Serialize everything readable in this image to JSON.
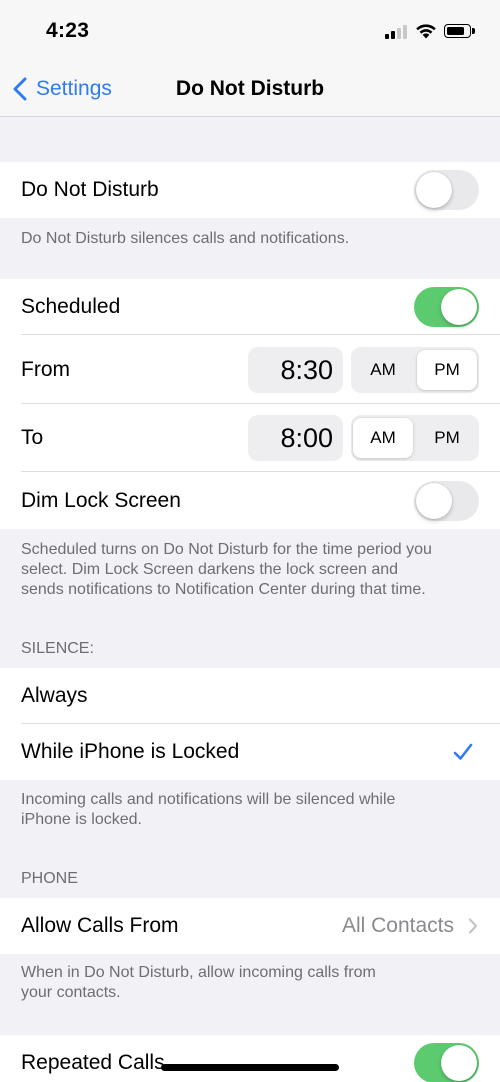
{
  "status_bar": {
    "time": "4:23"
  },
  "nav": {
    "back_label": "Settings",
    "title": "Do Not Disturb"
  },
  "dnd": {
    "label": "Do Not Disturb",
    "enabled": false,
    "footer": "Do Not Disturb silences calls and notifications."
  },
  "schedule": {
    "scheduled_label": "Scheduled",
    "scheduled_enabled": true,
    "from_label": "From",
    "from_time": "8:30",
    "from_period": "PM",
    "to_label": "To",
    "to_time": "8:00",
    "to_period": "AM",
    "am_label": "AM",
    "pm_label": "PM",
    "dim_label": "Dim Lock Screen",
    "dim_enabled": false,
    "footer_line1": "Scheduled turns on Do Not Disturb for the time period you",
    "footer_line2": "select. Dim Lock Screen darkens the lock screen and",
    "footer_line3": "sends notifications to Notification Center during that time."
  },
  "silence": {
    "header": "SILENCE:",
    "options": [
      "Always",
      "While iPhone is Locked"
    ],
    "selected": "While iPhone is Locked",
    "footer_line1": "Incoming calls and notifications will be silenced while",
    "footer_line2": "iPhone is locked."
  },
  "phone": {
    "header": "PHONE",
    "allow_calls_label": "Allow Calls From",
    "allow_calls_value": "All Contacts",
    "footer_line1": "When in Do Not Disturb, allow incoming calls from",
    "footer_line2": "your contacts.",
    "repeated_calls_label": "Repeated Calls",
    "repeated_calls_enabled": true
  },
  "colors": {
    "accent": "#2f7bf6",
    "toggle_on": "#5ccb6f",
    "toggle_off": "#e9e9eb",
    "background": "#f2f2f6"
  },
  "icons": [
    "chevron-left-icon",
    "cellular-signal-icon",
    "wifi-icon",
    "battery-icon",
    "checkmark-icon",
    "chevron-right-icon"
  ]
}
